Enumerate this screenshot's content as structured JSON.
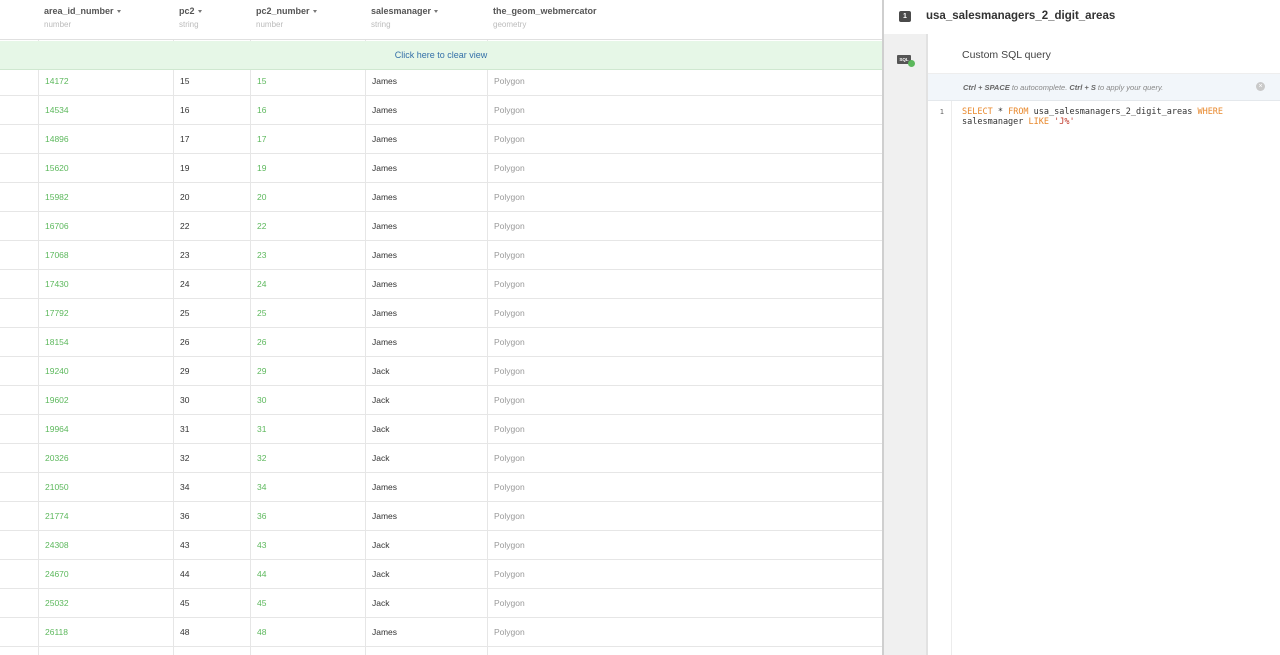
{
  "table": {
    "columns": [
      {
        "name": "area_id_number",
        "type": "number",
        "sortable": true
      },
      {
        "name": "pc2",
        "type": "string",
        "sortable": true
      },
      {
        "name": "pc2_number",
        "type": "number",
        "sortable": true
      },
      {
        "name": "salesmanager",
        "type": "string",
        "sortable": true
      },
      {
        "name": "the_geom_webmercator",
        "type": "geometry",
        "sortable": false
      }
    ],
    "clear_view_label": "Click here to clear view",
    "rows": [
      {
        "area_id_number": "14172",
        "pc2": "15",
        "pc2_number": "15",
        "salesmanager": "James",
        "the_geom_webmercator": "Polygon"
      },
      {
        "area_id_number": "14534",
        "pc2": "16",
        "pc2_number": "16",
        "salesmanager": "James",
        "the_geom_webmercator": "Polygon"
      },
      {
        "area_id_number": "14896",
        "pc2": "17",
        "pc2_number": "17",
        "salesmanager": "James",
        "the_geom_webmercator": "Polygon"
      },
      {
        "area_id_number": "15620",
        "pc2": "19",
        "pc2_number": "19",
        "salesmanager": "James",
        "the_geom_webmercator": "Polygon"
      },
      {
        "area_id_number": "15982",
        "pc2": "20",
        "pc2_number": "20",
        "salesmanager": "James",
        "the_geom_webmercator": "Polygon"
      },
      {
        "area_id_number": "16706",
        "pc2": "22",
        "pc2_number": "22",
        "salesmanager": "James",
        "the_geom_webmercator": "Polygon"
      },
      {
        "area_id_number": "17068",
        "pc2": "23",
        "pc2_number": "23",
        "salesmanager": "James",
        "the_geom_webmercator": "Polygon"
      },
      {
        "area_id_number": "17430",
        "pc2": "24",
        "pc2_number": "24",
        "salesmanager": "James",
        "the_geom_webmercator": "Polygon"
      },
      {
        "area_id_number": "17792",
        "pc2": "25",
        "pc2_number": "25",
        "salesmanager": "James",
        "the_geom_webmercator": "Polygon"
      },
      {
        "area_id_number": "18154",
        "pc2": "26",
        "pc2_number": "26",
        "salesmanager": "James",
        "the_geom_webmercator": "Polygon"
      },
      {
        "area_id_number": "19240",
        "pc2": "29",
        "pc2_number": "29",
        "salesmanager": "Jack",
        "the_geom_webmercator": "Polygon"
      },
      {
        "area_id_number": "19602",
        "pc2": "30",
        "pc2_number": "30",
        "salesmanager": "Jack",
        "the_geom_webmercator": "Polygon"
      },
      {
        "area_id_number": "19964",
        "pc2": "31",
        "pc2_number": "31",
        "salesmanager": "Jack",
        "the_geom_webmercator": "Polygon"
      },
      {
        "area_id_number": "20326",
        "pc2": "32",
        "pc2_number": "32",
        "salesmanager": "Jack",
        "the_geom_webmercator": "Polygon"
      },
      {
        "area_id_number": "21050",
        "pc2": "34",
        "pc2_number": "34",
        "salesmanager": "James",
        "the_geom_webmercator": "Polygon"
      },
      {
        "area_id_number": "21774",
        "pc2": "36",
        "pc2_number": "36",
        "salesmanager": "James",
        "the_geom_webmercator": "Polygon"
      },
      {
        "area_id_number": "24308",
        "pc2": "43",
        "pc2_number": "43",
        "salesmanager": "Jack",
        "the_geom_webmercator": "Polygon"
      },
      {
        "area_id_number": "24670",
        "pc2": "44",
        "pc2_number": "44",
        "salesmanager": "Jack",
        "the_geom_webmercator": "Polygon"
      },
      {
        "area_id_number": "25032",
        "pc2": "45",
        "pc2_number": "45",
        "salesmanager": "Jack",
        "the_geom_webmercator": "Polygon"
      },
      {
        "area_id_number": "26118",
        "pc2": "48",
        "pc2_number": "48",
        "salesmanager": "James",
        "the_geom_webmercator": "Polygon"
      }
    ]
  },
  "panel": {
    "layer_index": "1",
    "layer_title": "usa_salesmanagers_2_digit_areas",
    "sql_tool_icon_text": "SQL",
    "editor_title": "Custom SQL query",
    "hint": {
      "shortcut_1": "Ctrl + SPACE",
      "text_1": " to autocomplete. ",
      "shortcut_2": "Ctrl + S",
      "text_2": " to apply your query."
    },
    "close_glyph": "×",
    "line_number": "1",
    "query": {
      "select_kw": "SELECT",
      "star": " * ",
      "from_kw": "FROM",
      "table": " usa_salesmanagers_2_digit_areas ",
      "where_kw": "WHERE",
      "column": "salesmanager ",
      "like_kw": "LIKE",
      "pattern": " 'J%'"
    }
  },
  "colors": {
    "number_text": "#5cb85c",
    "clear_view_bg": "#e6f7e7",
    "sql_keyword": "#e8882c",
    "sql_string": "#c0392b"
  }
}
